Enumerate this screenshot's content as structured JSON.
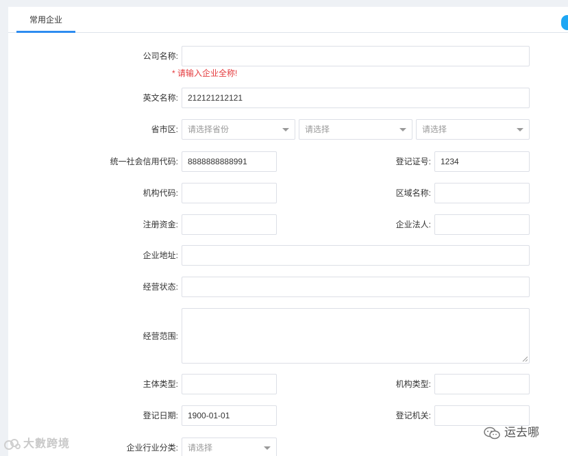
{
  "tabs": {
    "active_label": "常用企业"
  },
  "form": {
    "company_name": {
      "label": "公司名称:",
      "value": "",
      "error": "* 请输入企业全称!"
    },
    "english_name": {
      "label": "英文名称:",
      "value": "212121212121"
    },
    "region": {
      "label": "省市区:",
      "province_placeholder": "请选择省份",
      "city_placeholder": "请选择",
      "district_placeholder": "请选择"
    },
    "credit_code": {
      "label": "统一社会信用代码:",
      "value": "8888888888991"
    },
    "registration_no": {
      "label": "登记证号:",
      "value": "1234"
    },
    "org_code": {
      "label": "机构代码:",
      "value": ""
    },
    "region_name": {
      "label": "区域名称:",
      "value": ""
    },
    "registered_capital": {
      "label": "注册资金:",
      "value": ""
    },
    "legal_person": {
      "label": "企业法人:",
      "value": ""
    },
    "address": {
      "label": "企业地址:",
      "value": ""
    },
    "business_status": {
      "label": "经营状态:",
      "value": ""
    },
    "business_scope": {
      "label": "经营范围:",
      "value": ""
    },
    "entity_type": {
      "label": "主体类型:",
      "value": ""
    },
    "org_type": {
      "label": "机构类型:",
      "value": ""
    },
    "registration_date": {
      "label": "登记日期:",
      "value": "1900-01-01"
    },
    "registration_authority": {
      "label": "登记机关:",
      "value": ""
    },
    "industry": {
      "label": "企业行业分类:",
      "placeholder": "请选择"
    }
  },
  "watermarks": {
    "left": "大數跨境",
    "right": "运去哪"
  },
  "colors": {
    "accent": "#2d8cf0",
    "error": "#e4393c",
    "border": "#dcdfe6"
  }
}
